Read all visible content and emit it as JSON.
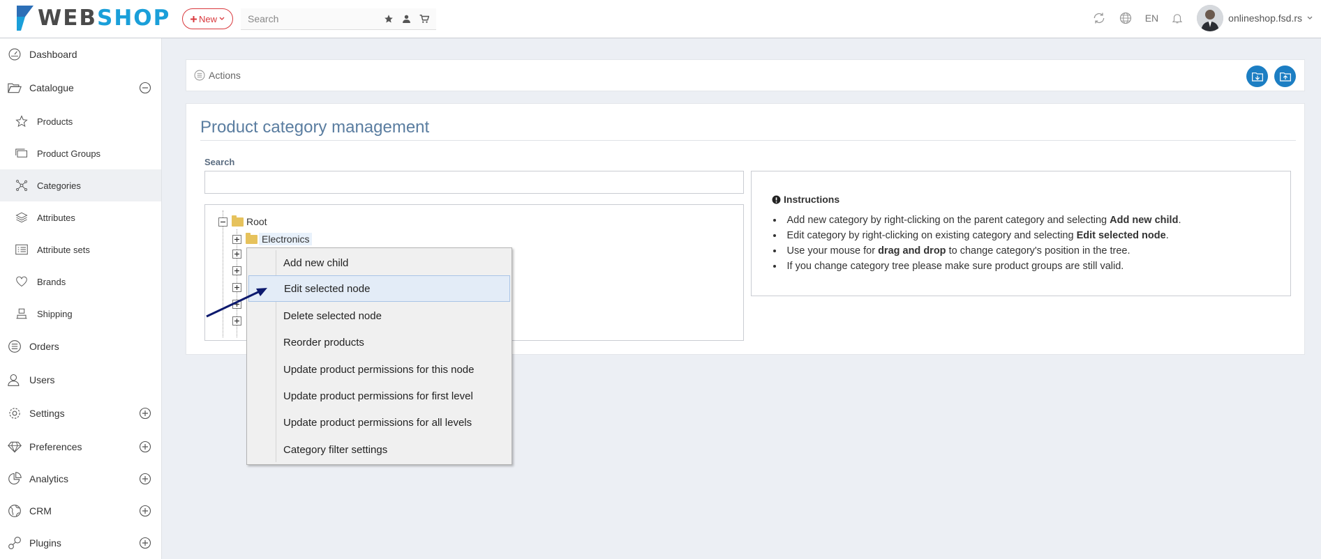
{
  "header": {
    "logo_text_a": "WEB",
    "logo_text_b": "SHOP",
    "new_button": "New",
    "search_placeholder": "Search",
    "language": "EN",
    "user_name": "onlineshop.fsd.rs"
  },
  "sidebar": {
    "items": [
      {
        "label": "Dashboard"
      },
      {
        "label": "Catalogue"
      },
      {
        "label": "Products"
      },
      {
        "label": "Product Groups"
      },
      {
        "label": "Categories"
      },
      {
        "label": "Attributes"
      },
      {
        "label": "Attribute sets"
      },
      {
        "label": "Brands"
      },
      {
        "label": "Shipping"
      },
      {
        "label": "Orders"
      },
      {
        "label": "Users"
      },
      {
        "label": "Settings"
      },
      {
        "label": "Preferences"
      },
      {
        "label": "Analytics"
      },
      {
        "label": "CRM"
      },
      {
        "label": "Plugins"
      }
    ]
  },
  "actions_bar": {
    "label": "Actions"
  },
  "panel": {
    "title": "Product category management",
    "search_label": "Search",
    "search_value": ""
  },
  "tree": {
    "root": "Root",
    "selected_node": "Electronics"
  },
  "instructions": {
    "title": "Instructions",
    "items": [
      {
        "pre": "Add new category by right-clicking on the parent category and selecting ",
        "bold": "Add new child",
        "post": "."
      },
      {
        "pre": "Edit category by right-clicking on existing category and selecting ",
        "bold": "Edit selected node",
        "post": "."
      },
      {
        "pre": "Use your mouse for ",
        "bold": "drag and drop",
        "post": " to change category's position in the tree."
      },
      {
        "pre": "If you change category tree please make sure product groups are still valid.",
        "bold": "",
        "post": ""
      }
    ]
  },
  "context_menu": {
    "items": [
      {
        "label": "Add new child"
      },
      {
        "label": "Edit selected node"
      },
      {
        "label": "Delete selected node"
      },
      {
        "label": "Reorder products"
      },
      {
        "label": "Update product permissions for this node"
      },
      {
        "label": "Update product permissions for first level"
      },
      {
        "label": "Update product permissions for all levels"
      },
      {
        "label": "Category filter settings"
      }
    ],
    "hovered": "Edit selected node"
  },
  "colors": {
    "accent": "#1c7ec3",
    "new_button": "#d9393d",
    "title": "#5a7da0",
    "folder": "#e6c25c",
    "arrow": "#0d1a6e"
  },
  "icons": [
    "search-icon",
    "star-icon",
    "user-icon",
    "cart-icon",
    "refresh-icon",
    "globe-icon",
    "bell-icon",
    "plus-icon",
    "chevron-down-icon",
    "info-icon",
    "list-icon",
    "folder-icon"
  ]
}
